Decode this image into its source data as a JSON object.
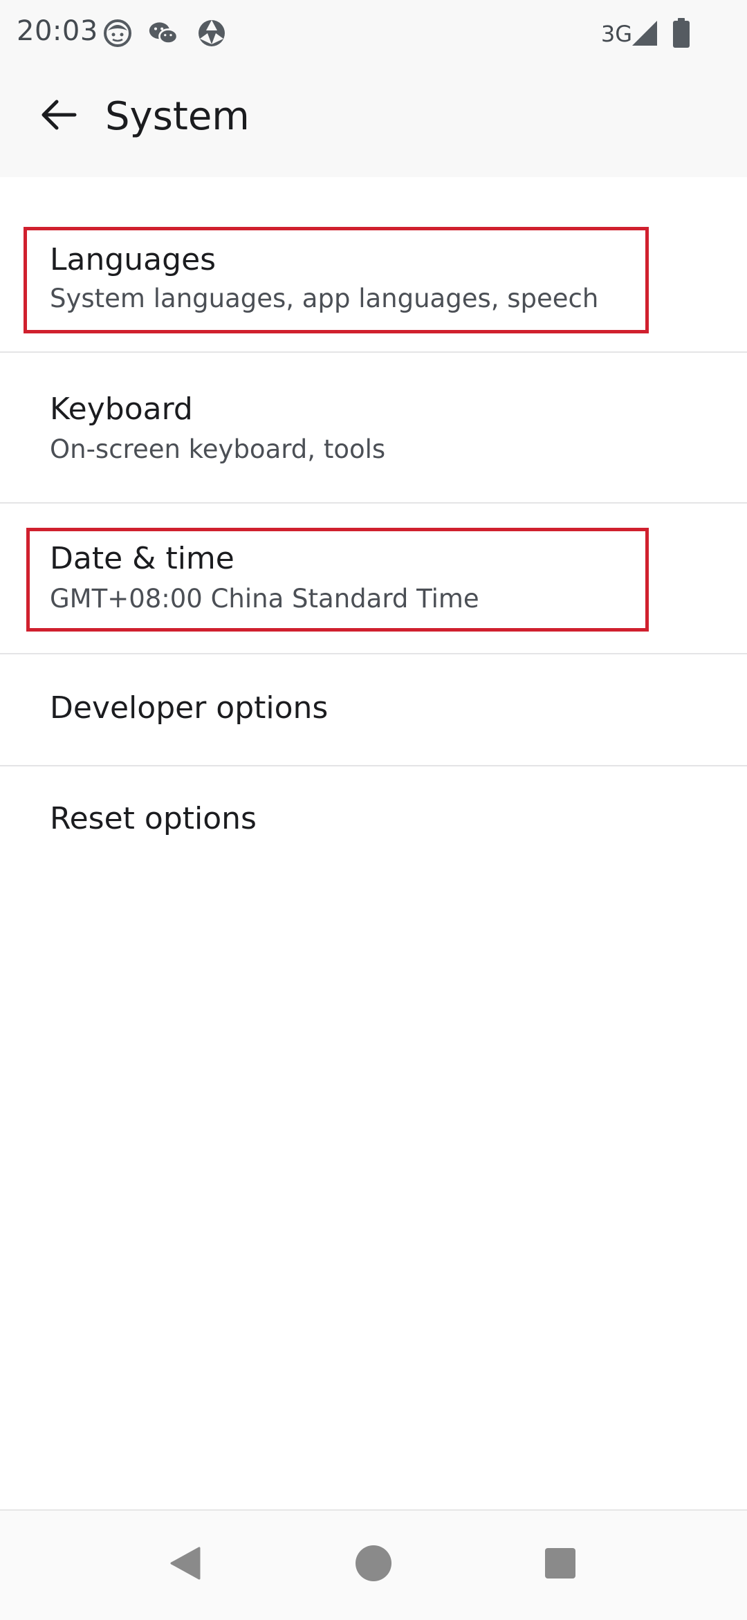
{
  "status_bar": {
    "time": "20:03",
    "network": "3G",
    "icons": [
      "face-notification-icon",
      "wechat-icon",
      "browser-icon",
      "signal-icon",
      "battery-icon"
    ]
  },
  "app_bar": {
    "title": "System",
    "back_icon": "arrow-back-icon"
  },
  "items": [
    {
      "title": "Languages",
      "subtitle": "System languages, app languages, speech",
      "highlighted": true
    },
    {
      "title": "Keyboard",
      "subtitle": "On-screen keyboard, tools",
      "highlighted": false
    },
    {
      "title": "Date & time",
      "subtitle": "GMT+08:00 China Standard Time",
      "highlighted": true
    },
    {
      "title": "Developer options",
      "highlighted": false
    },
    {
      "title": "Reset options",
      "highlighted": false
    }
  ],
  "nav_bar": {
    "icons": [
      "nav-back-icon",
      "nav-home-icon",
      "nav-recents-icon"
    ]
  },
  "colors": {
    "highlight": "#d0202e",
    "divider": "#e4e4e6",
    "text_primary": "#1b1c1f",
    "text_secondary": "#4b4f55"
  }
}
